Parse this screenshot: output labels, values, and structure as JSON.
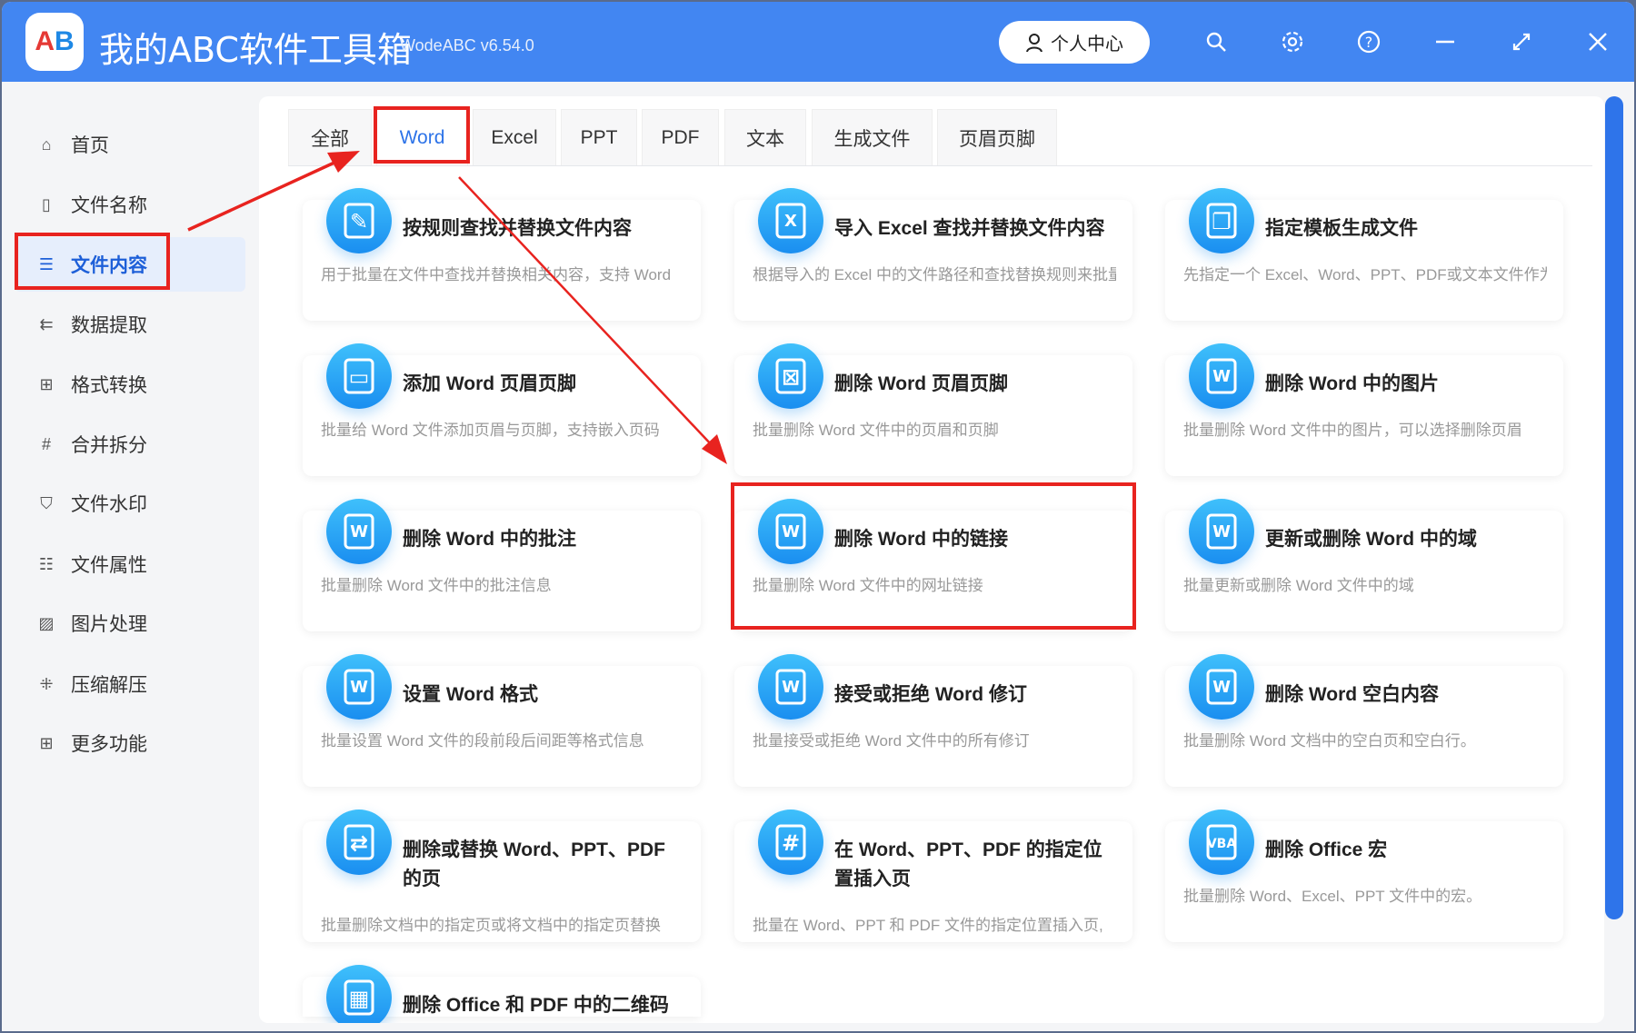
{
  "app": {
    "title": "我的ABC软件工具箱",
    "version": "WodeABC v6.54.0",
    "logo_text": "AB",
    "user_center": "个人中心"
  },
  "header_icons": [
    "search-icon",
    "settings-icon",
    "help-icon",
    "minimize-icon",
    "maximize-icon",
    "close-icon"
  ],
  "sidebar": {
    "items": [
      {
        "label": "首页",
        "icon": "⌂"
      },
      {
        "label": "文件名称",
        "icon": "▯"
      },
      {
        "label": "文件内容",
        "icon": "☰",
        "active": true
      },
      {
        "label": "数据提取",
        "icon": "⇇"
      },
      {
        "label": "格式转换",
        "icon": "⊞"
      },
      {
        "label": "合并拆分",
        "icon": "#"
      },
      {
        "label": "文件水印",
        "icon": "⛉"
      },
      {
        "label": "文件属性",
        "icon": "☷"
      },
      {
        "label": "图片处理",
        "icon": "▨"
      },
      {
        "label": "压缩解压",
        "icon": "⁜"
      },
      {
        "label": "更多功能",
        "icon": "⊞"
      }
    ]
  },
  "tabs": [
    "全部",
    "Word",
    "Excel",
    "PPT",
    "PDF",
    "文本",
    "生成文件",
    "页眉页脚"
  ],
  "active_tab": "Word",
  "cards": [
    {
      "title": "按规则查找并替换文件内容",
      "desc": "用于批量在文件中查找并替换相关内容，支持 Word",
      "glyph": "✎"
    },
    {
      "title": "导入 Excel 查找并替换文件内容",
      "desc": "根据导入的 Excel 中的文件路径和查找替换规则来批量",
      "glyph": "X"
    },
    {
      "title": "指定模板生成文件",
      "desc": "先指定一个 Excel、Word、PPT、PDF或文本文件作为模板",
      "glyph": "❐"
    },
    {
      "title": "添加 Word 页眉页脚",
      "desc": "批量给 Word 文件添加页眉与页脚，支持嵌入页码",
      "glyph": "▭"
    },
    {
      "title": "删除 Word 页眉页脚",
      "desc": "批量删除 Word 文件中的页眉和页脚",
      "glyph": "⊠"
    },
    {
      "title": "删除 Word 中的图片",
      "desc": "批量删除 Word 文件中的图片，可以选择删除页眉",
      "glyph": "W"
    },
    {
      "title": "删除 Word 中的批注",
      "desc": "批量删除 Word 文件中的批注信息",
      "glyph": "W"
    },
    {
      "title": "删除 Word 中的链接",
      "desc": "批量删除 Word 文件中的网址链接",
      "glyph": "W"
    },
    {
      "title": "更新或删除 Word 中的域",
      "desc": "批量更新或删除 Word 文件中的域",
      "glyph": "W"
    },
    {
      "title": "设置 Word 格式",
      "desc": "批量设置 Word 文件的段前段后间距等格式信息",
      "glyph": "W"
    },
    {
      "title": "接受或拒绝 Word 修订",
      "desc": "批量接受或拒绝 Word 文件中的所有修订",
      "glyph": "W"
    },
    {
      "title": "删除 Word 空白内容",
      "desc": "批量删除 Word 文档中的空白页和空白行。",
      "glyph": "W"
    },
    {
      "title": "删除或替换 Word、PPT、PDF 的页",
      "desc": "批量删除文档中的指定页或将文档中的指定页替换",
      "glyph": "⇄"
    },
    {
      "title": "在 Word、PPT、PDF 的指定位置插入页",
      "desc": "批量在 Word、PPT 和 PDF 文件的指定位置插入页,",
      "glyph": "#"
    },
    {
      "title": "删除 Office 宏",
      "desc": "批量删除 Word、Excel、PPT 文件中的宏。",
      "glyph": "VBA"
    },
    {
      "title": "删除 Office 和 PDF 中的二维码",
      "desc": "",
      "glyph": "▦"
    }
  ],
  "highlighted_card": "删除 Word 中的链接"
}
